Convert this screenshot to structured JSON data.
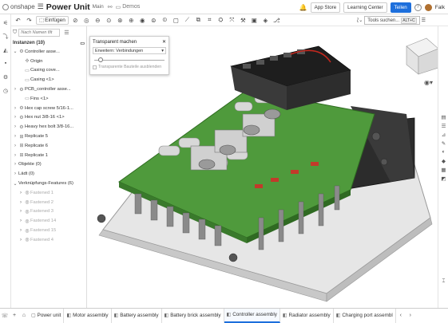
{
  "app": {
    "brand": "onshape"
  },
  "document": {
    "title": "Power Unit",
    "branch": "Main",
    "folder": "Demos"
  },
  "topbar": {
    "app_store": "App Store",
    "learning_center": "Learning Center",
    "share": "Teilen",
    "help": "?",
    "user": "Falk"
  },
  "toolbar": {
    "insert_label": "Einfügen",
    "tools_search_placeholder": "Tools suchen...",
    "shortcut": "ALT+C"
  },
  "panel": {
    "search_placeholder": "Nach Namen filt",
    "instances_header": "Instanzen (10)",
    "tree": [
      {
        "label": "Controller asse...",
        "indent": 0,
        "chev": "⌄",
        "icon": "⚙"
      },
      {
        "label": "Origin",
        "indent": 1,
        "chev": "",
        "icon": "✣"
      },
      {
        "label": "Casing cove...",
        "indent": 1,
        "chev": "",
        "icon": "▭"
      },
      {
        "label": "Casing <1>",
        "indent": 1,
        "chev": "",
        "icon": "▭"
      },
      {
        "label": "PCB_controller asse...",
        "indent": 0,
        "chev": "›",
        "icon": "⚙"
      },
      {
        "label": "Fins <1>",
        "indent": 1,
        "chev": "",
        "icon": "▭"
      },
      {
        "label": "Hex cap screw 5/16-1...",
        "indent": 0,
        "chev": "›",
        "icon": "⚙"
      },
      {
        "label": "Hex nut 3/8-16 <1>",
        "indent": 0,
        "chev": "›",
        "icon": "⚙"
      },
      {
        "label": "Heavy hex bolt 3/8-16...",
        "indent": 0,
        "chev": "›",
        "icon": "⚙"
      },
      {
        "label": "Replicate 5",
        "indent": 0,
        "chev": "›",
        "icon": "⊞"
      },
      {
        "label": "Replicate 6",
        "indent": 0,
        "chev": "›",
        "icon": "⊞"
      },
      {
        "label": "Replicate 1",
        "indent": 0,
        "chev": "›",
        "icon": "⊞"
      },
      {
        "label": "Objekte (0)",
        "indent": 0,
        "chev": "›",
        "icon": ""
      },
      {
        "label": "Lädt (0)",
        "indent": 0,
        "chev": "›",
        "icon": ""
      },
      {
        "label": "Verknüpfungs-Features (6)",
        "indent": 0,
        "chev": "⌄",
        "icon": ""
      },
      {
        "label": "Fastened 1",
        "indent": 1,
        "chev": "›",
        "icon": "◎",
        "dim": true
      },
      {
        "label": "Fastened 2",
        "indent": 1,
        "chev": "›",
        "icon": "◎",
        "dim": true
      },
      {
        "label": "Fastened 3",
        "indent": 1,
        "chev": "›",
        "icon": "◎",
        "dim": true
      },
      {
        "label": "Fastened 14",
        "indent": 1,
        "chev": "›",
        "icon": "◎",
        "dim": true
      },
      {
        "label": "Fastened 15",
        "indent": 1,
        "chev": "›",
        "icon": "◎",
        "dim": true
      },
      {
        "label": "Fastened 4",
        "indent": 1,
        "chev": "›",
        "icon": "◎",
        "dim": true
      }
    ]
  },
  "popup": {
    "title": "Transparent machen",
    "select_value": "Erweitern: Verbindungen",
    "slider_value": 0.08,
    "checkbox_label": "Transparente Bauteile ausblenden"
  },
  "tabs": [
    {
      "label": "Power unit",
      "icon": "▢",
      "active": false
    },
    {
      "label": "Motor assembly",
      "icon": "◧",
      "active": false
    },
    {
      "label": "Battery assembly",
      "icon": "◧",
      "active": false
    },
    {
      "label": "Battery brick assembly",
      "icon": "◧",
      "active": false
    },
    {
      "label": "Controller assembly",
      "icon": "◧",
      "active": true
    },
    {
      "label": "Radiator assembly",
      "icon": "◧",
      "active": false
    },
    {
      "label": "Charging port assembl",
      "icon": "◧",
      "active": false
    }
  ],
  "colors": {
    "accent": "#1d6fdc",
    "pcb": "#4f9a3c",
    "casing": "#eeeeee"
  }
}
